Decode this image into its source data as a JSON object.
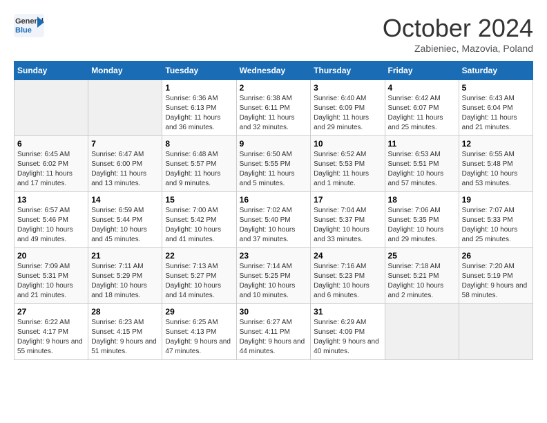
{
  "header": {
    "logo_general": "General",
    "logo_blue": "Blue",
    "month_title": "October 2024",
    "location": "Zabieniec, Mazovia, Poland"
  },
  "weekdays": [
    "Sunday",
    "Monday",
    "Tuesday",
    "Wednesday",
    "Thursday",
    "Friday",
    "Saturday"
  ],
  "weeks": [
    [
      {
        "day": "",
        "sunrise": "",
        "sunset": "",
        "daylight": ""
      },
      {
        "day": "",
        "sunrise": "",
        "sunset": "",
        "daylight": ""
      },
      {
        "day": "1",
        "sunrise": "Sunrise: 6:36 AM",
        "sunset": "Sunset: 6:13 PM",
        "daylight": "Daylight: 11 hours and 36 minutes."
      },
      {
        "day": "2",
        "sunrise": "Sunrise: 6:38 AM",
        "sunset": "Sunset: 6:11 PM",
        "daylight": "Daylight: 11 hours and 32 minutes."
      },
      {
        "day": "3",
        "sunrise": "Sunrise: 6:40 AM",
        "sunset": "Sunset: 6:09 PM",
        "daylight": "Daylight: 11 hours and 29 minutes."
      },
      {
        "day": "4",
        "sunrise": "Sunrise: 6:42 AM",
        "sunset": "Sunset: 6:07 PM",
        "daylight": "Daylight: 11 hours and 25 minutes."
      },
      {
        "day": "5",
        "sunrise": "Sunrise: 6:43 AM",
        "sunset": "Sunset: 6:04 PM",
        "daylight": "Daylight: 11 hours and 21 minutes."
      }
    ],
    [
      {
        "day": "6",
        "sunrise": "Sunrise: 6:45 AM",
        "sunset": "Sunset: 6:02 PM",
        "daylight": "Daylight: 11 hours and 17 minutes."
      },
      {
        "day": "7",
        "sunrise": "Sunrise: 6:47 AM",
        "sunset": "Sunset: 6:00 PM",
        "daylight": "Daylight: 11 hours and 13 minutes."
      },
      {
        "day": "8",
        "sunrise": "Sunrise: 6:48 AM",
        "sunset": "Sunset: 5:57 PM",
        "daylight": "Daylight: 11 hours and 9 minutes."
      },
      {
        "day": "9",
        "sunrise": "Sunrise: 6:50 AM",
        "sunset": "Sunset: 5:55 PM",
        "daylight": "Daylight: 11 hours and 5 minutes."
      },
      {
        "day": "10",
        "sunrise": "Sunrise: 6:52 AM",
        "sunset": "Sunset: 5:53 PM",
        "daylight": "Daylight: 11 hours and 1 minute."
      },
      {
        "day": "11",
        "sunrise": "Sunrise: 6:53 AM",
        "sunset": "Sunset: 5:51 PM",
        "daylight": "Daylight: 10 hours and 57 minutes."
      },
      {
        "day": "12",
        "sunrise": "Sunrise: 6:55 AM",
        "sunset": "Sunset: 5:48 PM",
        "daylight": "Daylight: 10 hours and 53 minutes."
      }
    ],
    [
      {
        "day": "13",
        "sunrise": "Sunrise: 6:57 AM",
        "sunset": "Sunset: 5:46 PM",
        "daylight": "Daylight: 10 hours and 49 minutes."
      },
      {
        "day": "14",
        "sunrise": "Sunrise: 6:59 AM",
        "sunset": "Sunset: 5:44 PM",
        "daylight": "Daylight: 10 hours and 45 minutes."
      },
      {
        "day": "15",
        "sunrise": "Sunrise: 7:00 AM",
        "sunset": "Sunset: 5:42 PM",
        "daylight": "Daylight: 10 hours and 41 minutes."
      },
      {
        "day": "16",
        "sunrise": "Sunrise: 7:02 AM",
        "sunset": "Sunset: 5:40 PM",
        "daylight": "Daylight: 10 hours and 37 minutes."
      },
      {
        "day": "17",
        "sunrise": "Sunrise: 7:04 AM",
        "sunset": "Sunset: 5:37 PM",
        "daylight": "Daylight: 10 hours and 33 minutes."
      },
      {
        "day": "18",
        "sunrise": "Sunrise: 7:06 AM",
        "sunset": "Sunset: 5:35 PM",
        "daylight": "Daylight: 10 hours and 29 minutes."
      },
      {
        "day": "19",
        "sunrise": "Sunrise: 7:07 AM",
        "sunset": "Sunset: 5:33 PM",
        "daylight": "Daylight: 10 hours and 25 minutes."
      }
    ],
    [
      {
        "day": "20",
        "sunrise": "Sunrise: 7:09 AM",
        "sunset": "Sunset: 5:31 PM",
        "daylight": "Daylight: 10 hours and 21 minutes."
      },
      {
        "day": "21",
        "sunrise": "Sunrise: 7:11 AM",
        "sunset": "Sunset: 5:29 PM",
        "daylight": "Daylight: 10 hours and 18 minutes."
      },
      {
        "day": "22",
        "sunrise": "Sunrise: 7:13 AM",
        "sunset": "Sunset: 5:27 PM",
        "daylight": "Daylight: 10 hours and 14 minutes."
      },
      {
        "day": "23",
        "sunrise": "Sunrise: 7:14 AM",
        "sunset": "Sunset: 5:25 PM",
        "daylight": "Daylight: 10 hours and 10 minutes."
      },
      {
        "day": "24",
        "sunrise": "Sunrise: 7:16 AM",
        "sunset": "Sunset: 5:23 PM",
        "daylight": "Daylight: 10 hours and 6 minutes."
      },
      {
        "day": "25",
        "sunrise": "Sunrise: 7:18 AM",
        "sunset": "Sunset: 5:21 PM",
        "daylight": "Daylight: 10 hours and 2 minutes."
      },
      {
        "day": "26",
        "sunrise": "Sunrise: 7:20 AM",
        "sunset": "Sunset: 5:19 PM",
        "daylight": "Daylight: 9 hours and 58 minutes."
      }
    ],
    [
      {
        "day": "27",
        "sunrise": "Sunrise: 6:22 AM",
        "sunset": "Sunset: 4:17 PM",
        "daylight": "Daylight: 9 hours and 55 minutes."
      },
      {
        "day": "28",
        "sunrise": "Sunrise: 6:23 AM",
        "sunset": "Sunset: 4:15 PM",
        "daylight": "Daylight: 9 hours and 51 minutes."
      },
      {
        "day": "29",
        "sunrise": "Sunrise: 6:25 AM",
        "sunset": "Sunset: 4:13 PM",
        "daylight": "Daylight: 9 hours and 47 minutes."
      },
      {
        "day": "30",
        "sunrise": "Sunrise: 6:27 AM",
        "sunset": "Sunset: 4:11 PM",
        "daylight": "Daylight: 9 hours and 44 minutes."
      },
      {
        "day": "31",
        "sunrise": "Sunrise: 6:29 AM",
        "sunset": "Sunset: 4:09 PM",
        "daylight": "Daylight: 9 hours and 40 minutes."
      },
      {
        "day": "",
        "sunrise": "",
        "sunset": "",
        "daylight": ""
      },
      {
        "day": "",
        "sunrise": "",
        "sunset": "",
        "daylight": ""
      }
    ]
  ]
}
